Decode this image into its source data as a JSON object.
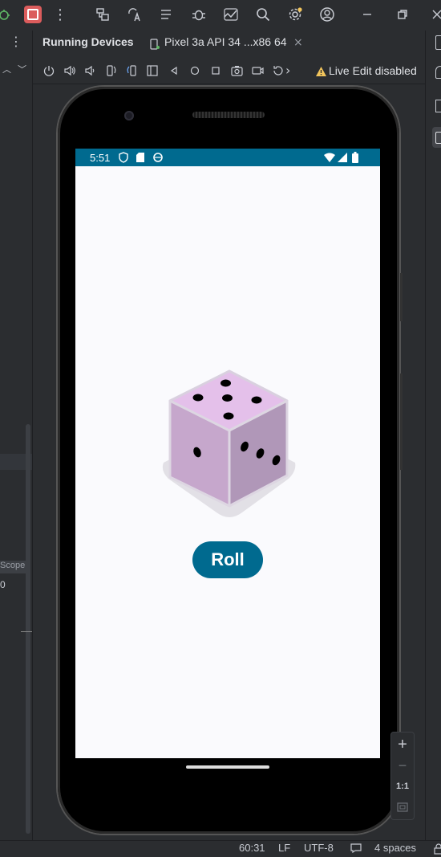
{
  "tool_window": {
    "title": "Running Devices",
    "device_tab": "Pixel 3a API 34 ...x86 64",
    "live_edit": "Live Edit disabled"
  },
  "left_panel": {
    "scope_label": "Scope",
    "number": "0"
  },
  "device": {
    "status_time": "5:51",
    "roll_label": "Roll"
  },
  "zoom": {
    "in": "+",
    "out": "−",
    "actual": "1:1"
  },
  "status_bar": {
    "position": "60:31",
    "line_ending": "LF",
    "encoding": "UTF-8",
    "indent": "4 spaces"
  },
  "colors": {
    "accent": "#006a8f",
    "stop": "#db5c5c",
    "warning": "#f2c55c"
  }
}
